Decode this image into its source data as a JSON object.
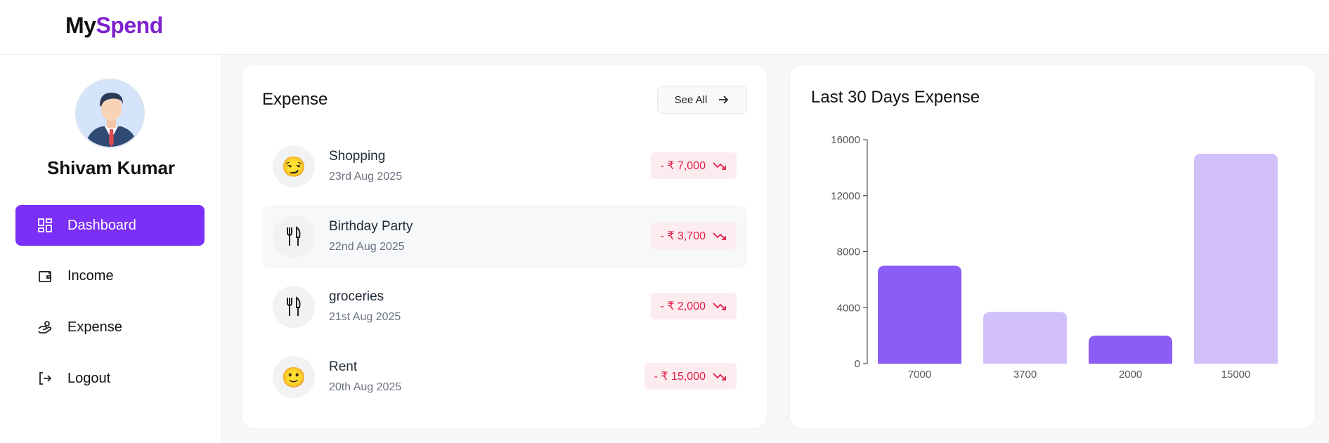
{
  "brand": {
    "part1": "My",
    "part2": "Spend"
  },
  "user": {
    "name": "Shivam Kumar"
  },
  "nav": [
    {
      "label": "Dashboard",
      "icon": "dashboard-icon",
      "active": true
    },
    {
      "label": "Income",
      "icon": "wallet-icon",
      "active": false
    },
    {
      "label": "Expense",
      "icon": "hand-coins-icon",
      "active": false
    },
    {
      "label": "Logout",
      "icon": "logout-icon",
      "active": false
    }
  ],
  "expense_card": {
    "title": "Expense",
    "see_all_label": "See All",
    "items": [
      {
        "name": "Shopping",
        "date": "23rd Aug 2025",
        "amount": "- ₹ 7,000",
        "emoji": "😏"
      },
      {
        "name": "Birthday Party",
        "date": "22nd Aug 2025",
        "amount": "- ₹ 3,700",
        "emoji": "🍴"
      },
      {
        "name": "groceries",
        "date": "21st Aug 2025",
        "amount": "- ₹ 2,000",
        "emoji": "🍴"
      },
      {
        "name": "Rent",
        "date": "20th Aug 2025",
        "amount": "- ₹ 15,000",
        "emoji": "🙂"
      }
    ]
  },
  "chart_card": {
    "title": "Last 30 Days Expense"
  },
  "colors": {
    "accent": "#7b2ff7",
    "bar_dark": "#8b5cf6",
    "bar_light": "#d1c0fa",
    "amount_red": "#e11d48"
  },
  "chart_data": {
    "type": "bar",
    "categories": [
      "7000",
      "3700",
      "2000",
      "15000"
    ],
    "values": [
      7000,
      3700,
      2000,
      15000
    ],
    "yticks": [
      "0",
      "4000",
      "8000",
      "12000",
      "16000"
    ],
    "ylim": [
      0,
      16000
    ],
    "title": "Last 30 Days Expense",
    "xlabel": "",
    "ylabel": "",
    "grid": false
  }
}
